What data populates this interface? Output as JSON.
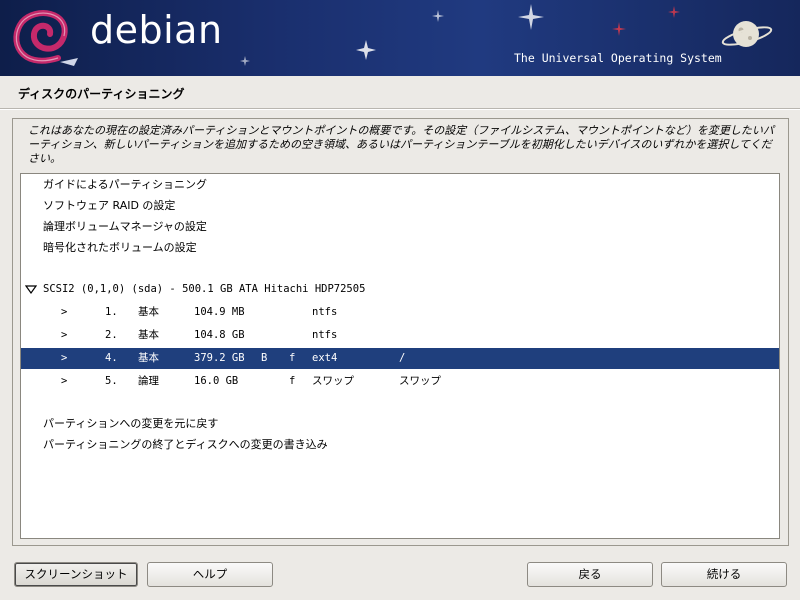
{
  "banner": {
    "logo_text": "debian",
    "tagline": "The Universal Operating System"
  },
  "page": {
    "title": "ディスクのパーティショニング",
    "description": "これはあなたの現在の設定済みパーティションとマウントポイントの概要です。その設定（ファイルシステム、マウントポイントなど）を変更したいパーティション、新しいパーティションを追加するための空き領域、あるいはパーティションテーブルを初期化したいデバイスのいずれかを選択してください。"
  },
  "list": {
    "menu_items": [
      "ガイドによるパーティショニング",
      "ソフトウェア RAID の設定",
      "論理ボリュームマネージャの設定",
      "暗号化されたボリュームの設定"
    ],
    "disk": {
      "expander": "▽",
      "label": "SCSI2 (0,1,0) (sda) - 500.1 GB ATA Hitachi HDP72505"
    },
    "partitions": [
      {
        "arrow": ">",
        "num": "1.",
        "type": "基本",
        "size": "104.9 MB",
        "boot": "",
        "fmt": "",
        "fs": "ntfs",
        "mount": ""
      },
      {
        "arrow": ">",
        "num": "2.",
        "type": "基本",
        "size": "104.8 GB",
        "boot": "",
        "fmt": "",
        "fs": "ntfs",
        "mount": ""
      },
      {
        "arrow": ">",
        "num": "4.",
        "type": "基本",
        "size": "379.2 GB",
        "boot": "B",
        "fmt": "f",
        "fs": "ext4",
        "mount": "/"
      },
      {
        "arrow": ">",
        "num": "5.",
        "type": "論理",
        "size": "16.0 GB",
        "boot": "",
        "fmt": "f",
        "fs": "スワップ",
        "mount": "スワップ"
      }
    ],
    "actions": [
      "パーティションへの変更を元に戻す",
      "パーティショニングの終了とディスクへの変更の書き込み"
    ]
  },
  "buttons": {
    "screenshot": "スクリーンショット",
    "help": "ヘルプ",
    "back": "戻る",
    "continue": "続ける"
  },
  "colors": {
    "selection": "#1f3f7d",
    "banner": "#1a2f6e"
  },
  "icons": [
    "debian-swirl-icon",
    "planet-icon",
    "star-icon"
  ]
}
